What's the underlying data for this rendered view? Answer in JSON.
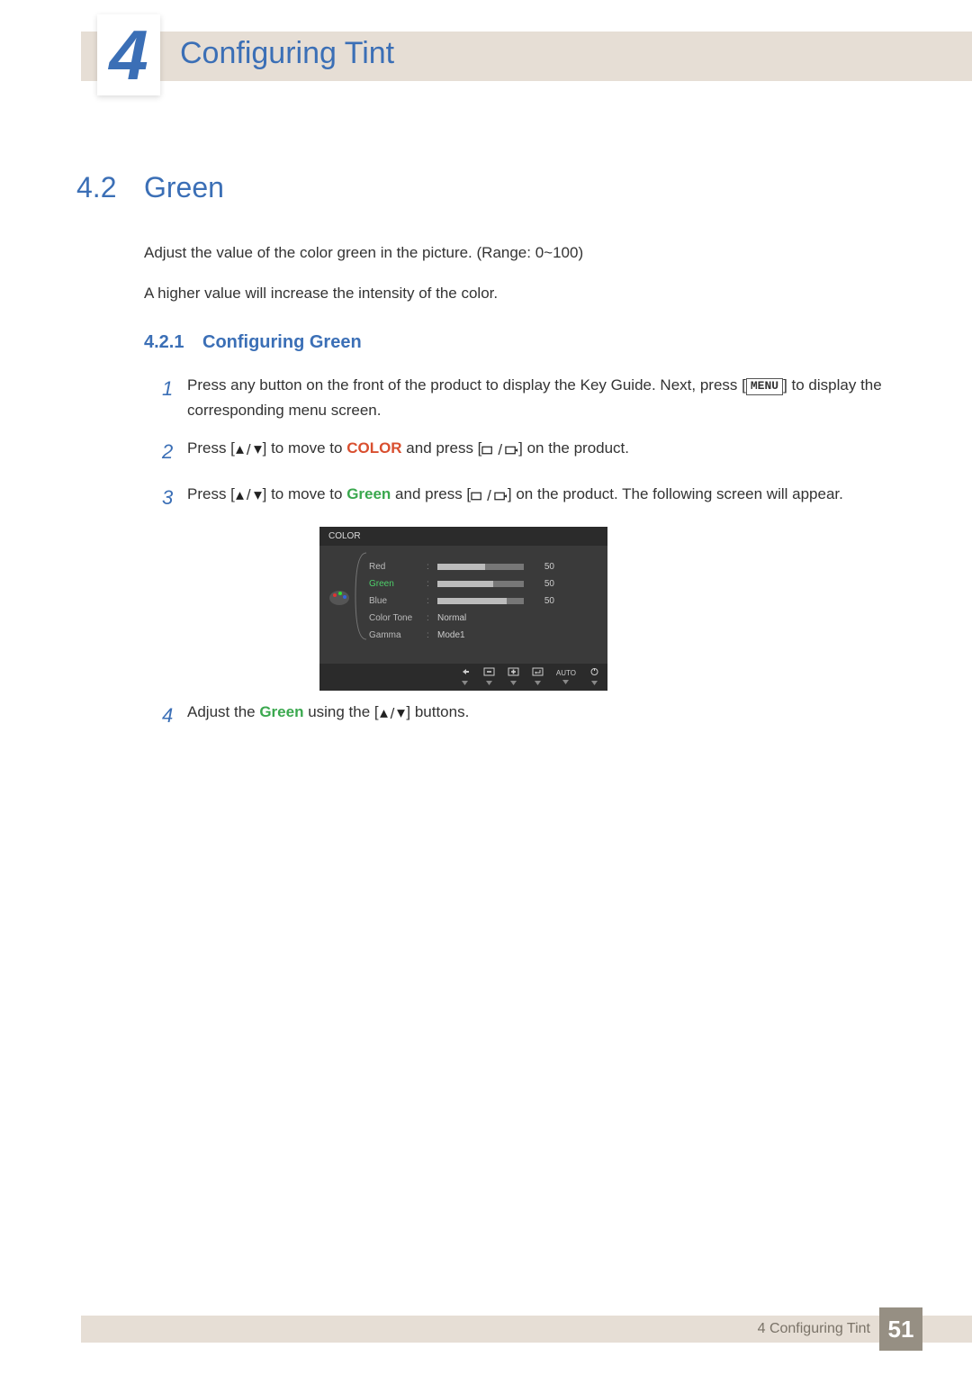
{
  "header": {
    "chapter_number": "4",
    "chapter_title": "Configuring Tint"
  },
  "section": {
    "number": "4.2",
    "title": "Green",
    "intro1": "Adjust the value of the color green in the picture. (Range: 0~100)",
    "intro2": "A higher value will increase the intensity of the color."
  },
  "subsection": {
    "number": "4.2.1",
    "title": "Configuring Green"
  },
  "steps": {
    "s1": {
      "num": "1",
      "a": "Press any button on the front of the product to display the Key Guide. Next, press [",
      "menu": "MENU",
      "b": "] to display the corresponding menu screen."
    },
    "s2": {
      "num": "2",
      "a": "Press [",
      "b": "] to move to ",
      "color": "COLOR",
      "c": " and press [",
      "d": "] on the product."
    },
    "s3": {
      "num": "3",
      "a": "Press [",
      "b": "] to move to ",
      "green": "Green",
      "c": " and press [",
      "d": "] on the product. The following screen will appear."
    },
    "s4": {
      "num": "4",
      "a": "Adjust the ",
      "green": "Green",
      "b": " using the [",
      "c": "] buttons."
    }
  },
  "osd": {
    "title": "COLOR",
    "items": {
      "red": {
        "label": "Red",
        "value": "50",
        "fill": 55
      },
      "green": {
        "label": "Green",
        "value": "50",
        "fill": 65
      },
      "blue": {
        "label": "Blue",
        "value": "50",
        "fill": 80
      },
      "colortone": {
        "label": "Color Tone",
        "text": "Normal"
      },
      "gamma": {
        "label": "Gamma",
        "text": "Mode1"
      }
    },
    "footer": {
      "auto": "AUTO"
    }
  },
  "footer": {
    "text": "4 Configuring Tint",
    "page": "51"
  }
}
